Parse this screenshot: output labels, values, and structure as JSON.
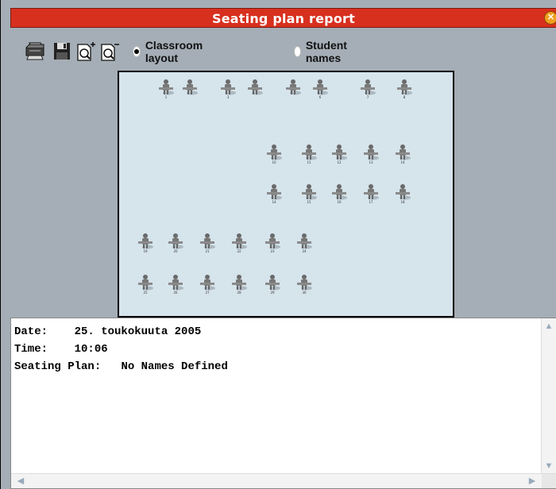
{
  "window": {
    "title": "Seating plan report",
    "close_icon": "close-icon"
  },
  "toolbar": {
    "print_icon": "printer-icon",
    "save_icon": "floppy-save-icon",
    "zoom_in_icon": "zoom-in-icon",
    "zoom_out_icon": "zoom-out-icon",
    "options": [
      {
        "label": "Classroom layout",
        "selected": true
      },
      {
        "label": "Student names",
        "selected": false
      }
    ]
  },
  "layout": {
    "background": "#d6e4ec",
    "seat_icon": "student-desk-icon",
    "seats": [
      {
        "label": "1"
      },
      {
        "label": ""
      },
      {
        "label": "3"
      },
      {
        "label": ""
      },
      {
        "label": ""
      },
      {
        "label": "6"
      },
      {
        "label": "7"
      },
      {
        "label": "8"
      },
      {
        "label": "10"
      },
      {
        "label": "11"
      },
      {
        "label": "12"
      },
      {
        "label": "13"
      },
      {
        "label": "14"
      },
      {
        "label": "14"
      },
      {
        "label": "15"
      },
      {
        "label": "16"
      },
      {
        "label": "17"
      },
      {
        "label": "18"
      },
      {
        "label": "19"
      },
      {
        "label": "20"
      },
      {
        "label": "21"
      },
      {
        "label": "22"
      },
      {
        "label": "23"
      },
      {
        "label": "24"
      },
      {
        "label": "25"
      },
      {
        "label": "26"
      },
      {
        "label": "27"
      },
      {
        "label": "28"
      },
      {
        "label": "29"
      },
      {
        "label": "30"
      }
    ]
  },
  "report": {
    "date_label": "Date:",
    "date_value": "25. toukokuuta 2005",
    "time_label": "Time:",
    "time_value": "10:06",
    "plan_label": "Seating Plan:",
    "plan_value": "No Names Defined"
  },
  "colors": {
    "title_bar": "#d7301e",
    "window_bg": "#a5aeb6"
  }
}
